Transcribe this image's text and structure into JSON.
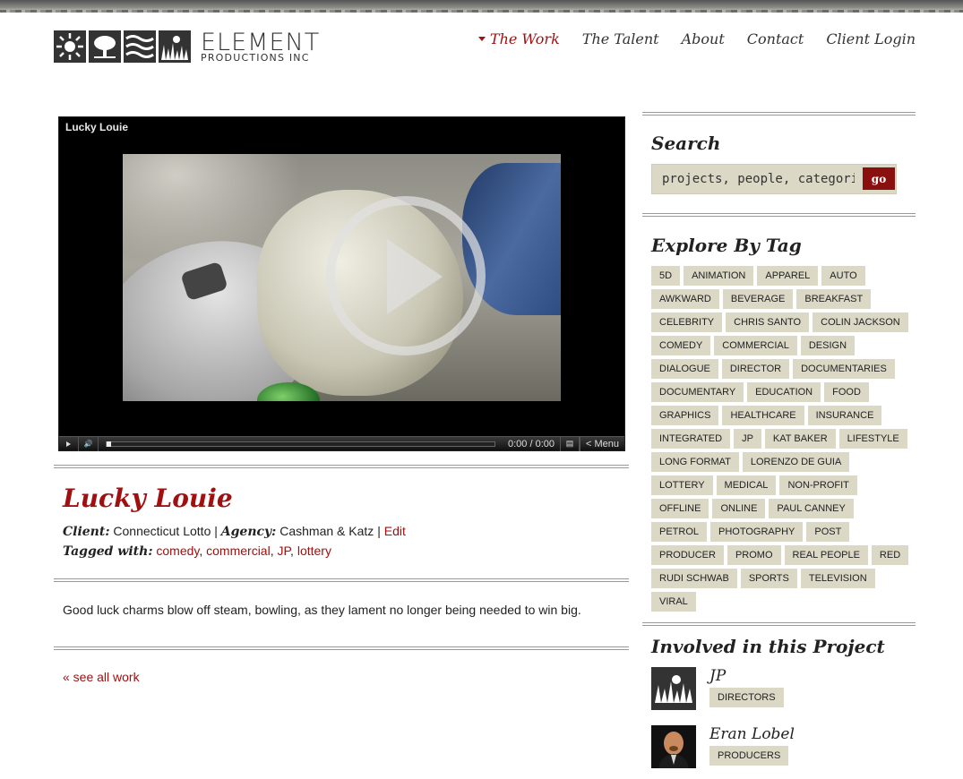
{
  "brand": {
    "name": "ELEMENT",
    "subtitle": "PRODUCTIONS INC"
  },
  "nav": [
    {
      "label": "The Work",
      "active": true
    },
    {
      "label": "The Talent"
    },
    {
      "label": "About"
    },
    {
      "label": "Contact"
    },
    {
      "label": "Client Login"
    }
  ],
  "player": {
    "title": "Lucky Louie",
    "time_current": "0:00",
    "time_separator": "/",
    "time_total": "0:00",
    "menu_label": "Menu",
    "menu_icon": "share-icon"
  },
  "project": {
    "title": "Lucky Louie",
    "client_label": "Client:",
    "client": "Connecticut Lotto",
    "agency_label": "Agency:",
    "agency": "Cashman & Katz",
    "separator": "|",
    "edit_label": "Edit",
    "tagged_label": "Tagged with:",
    "tags": [
      "comedy",
      "commercial",
      "JP",
      "lottery"
    ],
    "description": "Good luck charms blow off steam, bowling, as they lament no longer being needed to win big.",
    "see_all": "« see all work"
  },
  "sidebar": {
    "search_heading": "Search",
    "search_placeholder": "projects, people, categories..",
    "search_button": "go",
    "tag_heading": "Explore By Tag",
    "tags": [
      "5D",
      "ANIMATION",
      "APPAREL",
      "AUTO",
      "AWKWARD",
      "BEVERAGE",
      "BREAKFAST",
      "CELEBRITY",
      "CHRIS SANTO",
      "COLIN JACKSON",
      "COMEDY",
      "COMMERCIAL",
      "DESIGN",
      "DIALOGUE",
      "DIRECTOR",
      "DOCUMENTARIES",
      "DOCUMENTARY",
      "EDUCATION",
      "FOOD",
      "GRAPHICS",
      "HEALTHCARE",
      "INSURANCE",
      "INTEGRATED",
      "JP",
      "KAT BAKER",
      "LIFESTYLE",
      "LONG FORMAT",
      "LORENZO DE GUIA",
      "LOTTERY",
      "MEDICAL",
      "NON-PROFIT",
      "OFFLINE",
      "ONLINE",
      "PAUL CANNEY",
      "PETROL",
      "PHOTOGRAPHY",
      "POST",
      "PRODUCER",
      "PROMO",
      "REAL PEOPLE",
      "RED",
      "RUDI SCHWAB",
      "SPORTS",
      "TELEVISION",
      "VIRAL"
    ],
    "involved_heading": "Involved in this Project",
    "people": [
      {
        "name": "JP",
        "role": "DIRECTORS"
      },
      {
        "name": "Eran Lobel",
        "role": "PRODUCERS"
      }
    ]
  },
  "colors": {
    "accent": "#a01010",
    "tag_bg": "#dcd8c6",
    "button": "#8a1010"
  }
}
